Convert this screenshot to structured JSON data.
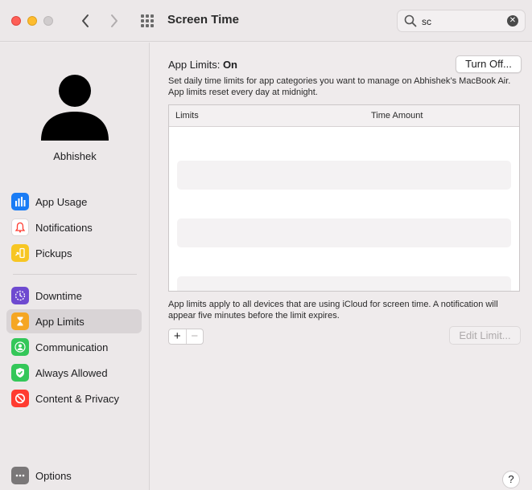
{
  "window": {
    "title": "Screen Time",
    "search_value": "sc"
  },
  "user": {
    "name": "Abhishek"
  },
  "sidebar": {
    "items": [
      {
        "label": "App Usage",
        "icon": "bar-chart-icon",
        "color": "#1a7cf5"
      },
      {
        "label": "Notifications",
        "icon": "bell-icon",
        "color": "#ffffff"
      },
      {
        "label": "Pickups",
        "icon": "pickup-icon",
        "color": "#f7c623"
      },
      {
        "label": "Downtime",
        "icon": "downtime-icon",
        "color": "#6e4ad0"
      },
      {
        "label": "App Limits",
        "icon": "hourglass-icon",
        "color": "#f5a623",
        "active": true
      },
      {
        "label": "Communication",
        "icon": "person-icon",
        "color": "#34c759"
      },
      {
        "label": "Always Allowed",
        "icon": "check-shield-icon",
        "color": "#34c759"
      },
      {
        "label": "Content & Privacy",
        "icon": "no-entry-icon",
        "color": "#ff3b30"
      }
    ],
    "options_label": "Options"
  },
  "main": {
    "title_prefix": "App Limits:",
    "title_status": "On",
    "turn_off_label": "Turn Off...",
    "description": "Set daily time limits for app categories you want to manage on Abhishek’s MacBook Air. App limits reset every day at midnight.",
    "table": {
      "columns": [
        "Limits",
        "Time Amount"
      ]
    },
    "note": "App limits apply to all devices that are using iCloud for screen time. A notification will appear five minutes before the limit expires.",
    "add_label": "+",
    "remove_label": "−",
    "edit_limit_label": "Edit Limit...",
    "help_label": "?"
  }
}
